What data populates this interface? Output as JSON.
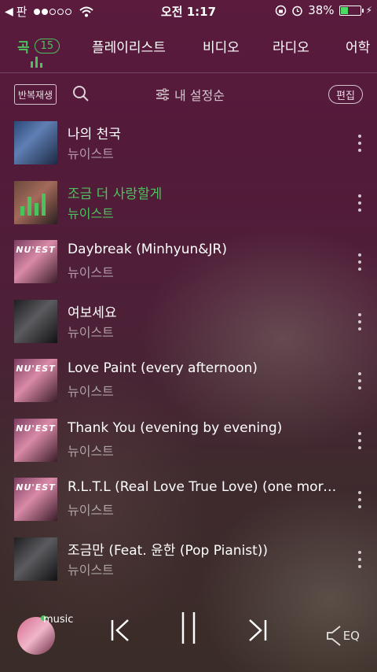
{
  "status_bar": {
    "back_label": "판",
    "time": "오전 1:17",
    "battery": "38%",
    "battery_level": 0.38
  },
  "tabs": [
    {
      "label": "곡",
      "count": "15",
      "active": true
    },
    {
      "label": "플레이리스트"
    },
    {
      "label": "비디오"
    },
    {
      "label": "라디오"
    },
    {
      "label": "어학"
    }
  ],
  "toolbar": {
    "repeat_label": "반복재생",
    "sort_label": "내 설정순",
    "edit_label": "편집"
  },
  "songs": [
    {
      "title": "나의 천국",
      "artist": "뉴이스트",
      "art": "blue"
    },
    {
      "title": "조금 더 사랑할게",
      "artist": "뉴이스트",
      "art": "red",
      "playing": true
    },
    {
      "title": "Daybreak (Minhyun&JR)",
      "artist": "뉴이스트",
      "art": "purple",
      "art_text": "NU'EST"
    },
    {
      "title": "여보세요",
      "artist": "뉴이스트",
      "art": "dark"
    },
    {
      "title": "Love Paint (every afternoon)",
      "artist": "뉴이스트",
      "art": "purple",
      "art_text": "NU'EST"
    },
    {
      "title": "Thank You (evening by evening)",
      "artist": "뉴이스트",
      "art": "purple",
      "art_text": "NU'EST"
    },
    {
      "title": "R.L.T.L (Real Love True Love) (one morn...",
      "artist": "뉴이스트",
      "art": "purple",
      "art_text": "NU'EST"
    },
    {
      "title": "조금만 (Feat. 윤한 (Pop Pianist))",
      "artist": "뉴이스트",
      "art": "dark"
    }
  ],
  "player": {
    "badge": "music",
    "eq_label": "EQ"
  },
  "colors": {
    "accent": "#4cc25e",
    "background": "#541a3a"
  }
}
